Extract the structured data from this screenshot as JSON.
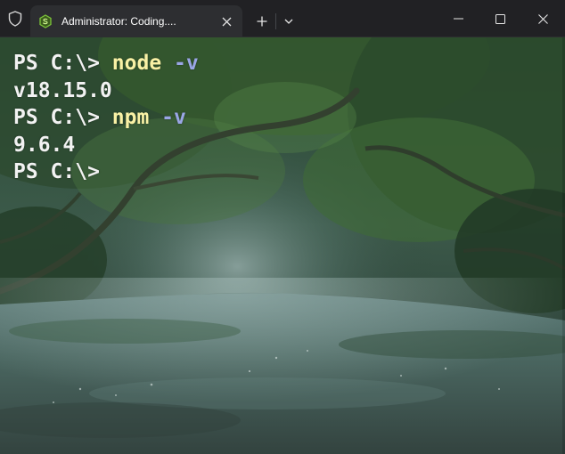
{
  "tab": {
    "title": "Administrator: Coding....",
    "close_label": "✕"
  },
  "titlebar": {
    "new_tab_label": "+",
    "dropdown_label": "⌄",
    "minimize_label": "—",
    "maximize_label": "☐",
    "close_label": "✕"
  },
  "icons": {
    "shield": "shield-icon",
    "tab": "node-icon",
    "close": "close-icon",
    "new_tab": "plus-icon",
    "dropdown": "chevron-down-icon",
    "minimize": "minimize-icon",
    "maximize": "maximize-icon",
    "window_close": "window-close-icon"
  },
  "terminal": {
    "lines": [
      {
        "prompt": "PS C:\\> ",
        "command": "node",
        "flag": " -v"
      },
      {
        "output": "v18.15.0"
      },
      {
        "prompt": "PS C:\\> ",
        "command": "npm",
        "flag": " -v"
      },
      {
        "output": "9.6.4"
      },
      {
        "prompt": "PS C:\\> "
      }
    ]
  },
  "colors": {
    "titlebar": "#212124",
    "tab": "#2d2e31",
    "prompt_text": "#f2f2f2",
    "command_text": "#f9f1a5",
    "flag_text": "#9aa6e6"
  }
}
